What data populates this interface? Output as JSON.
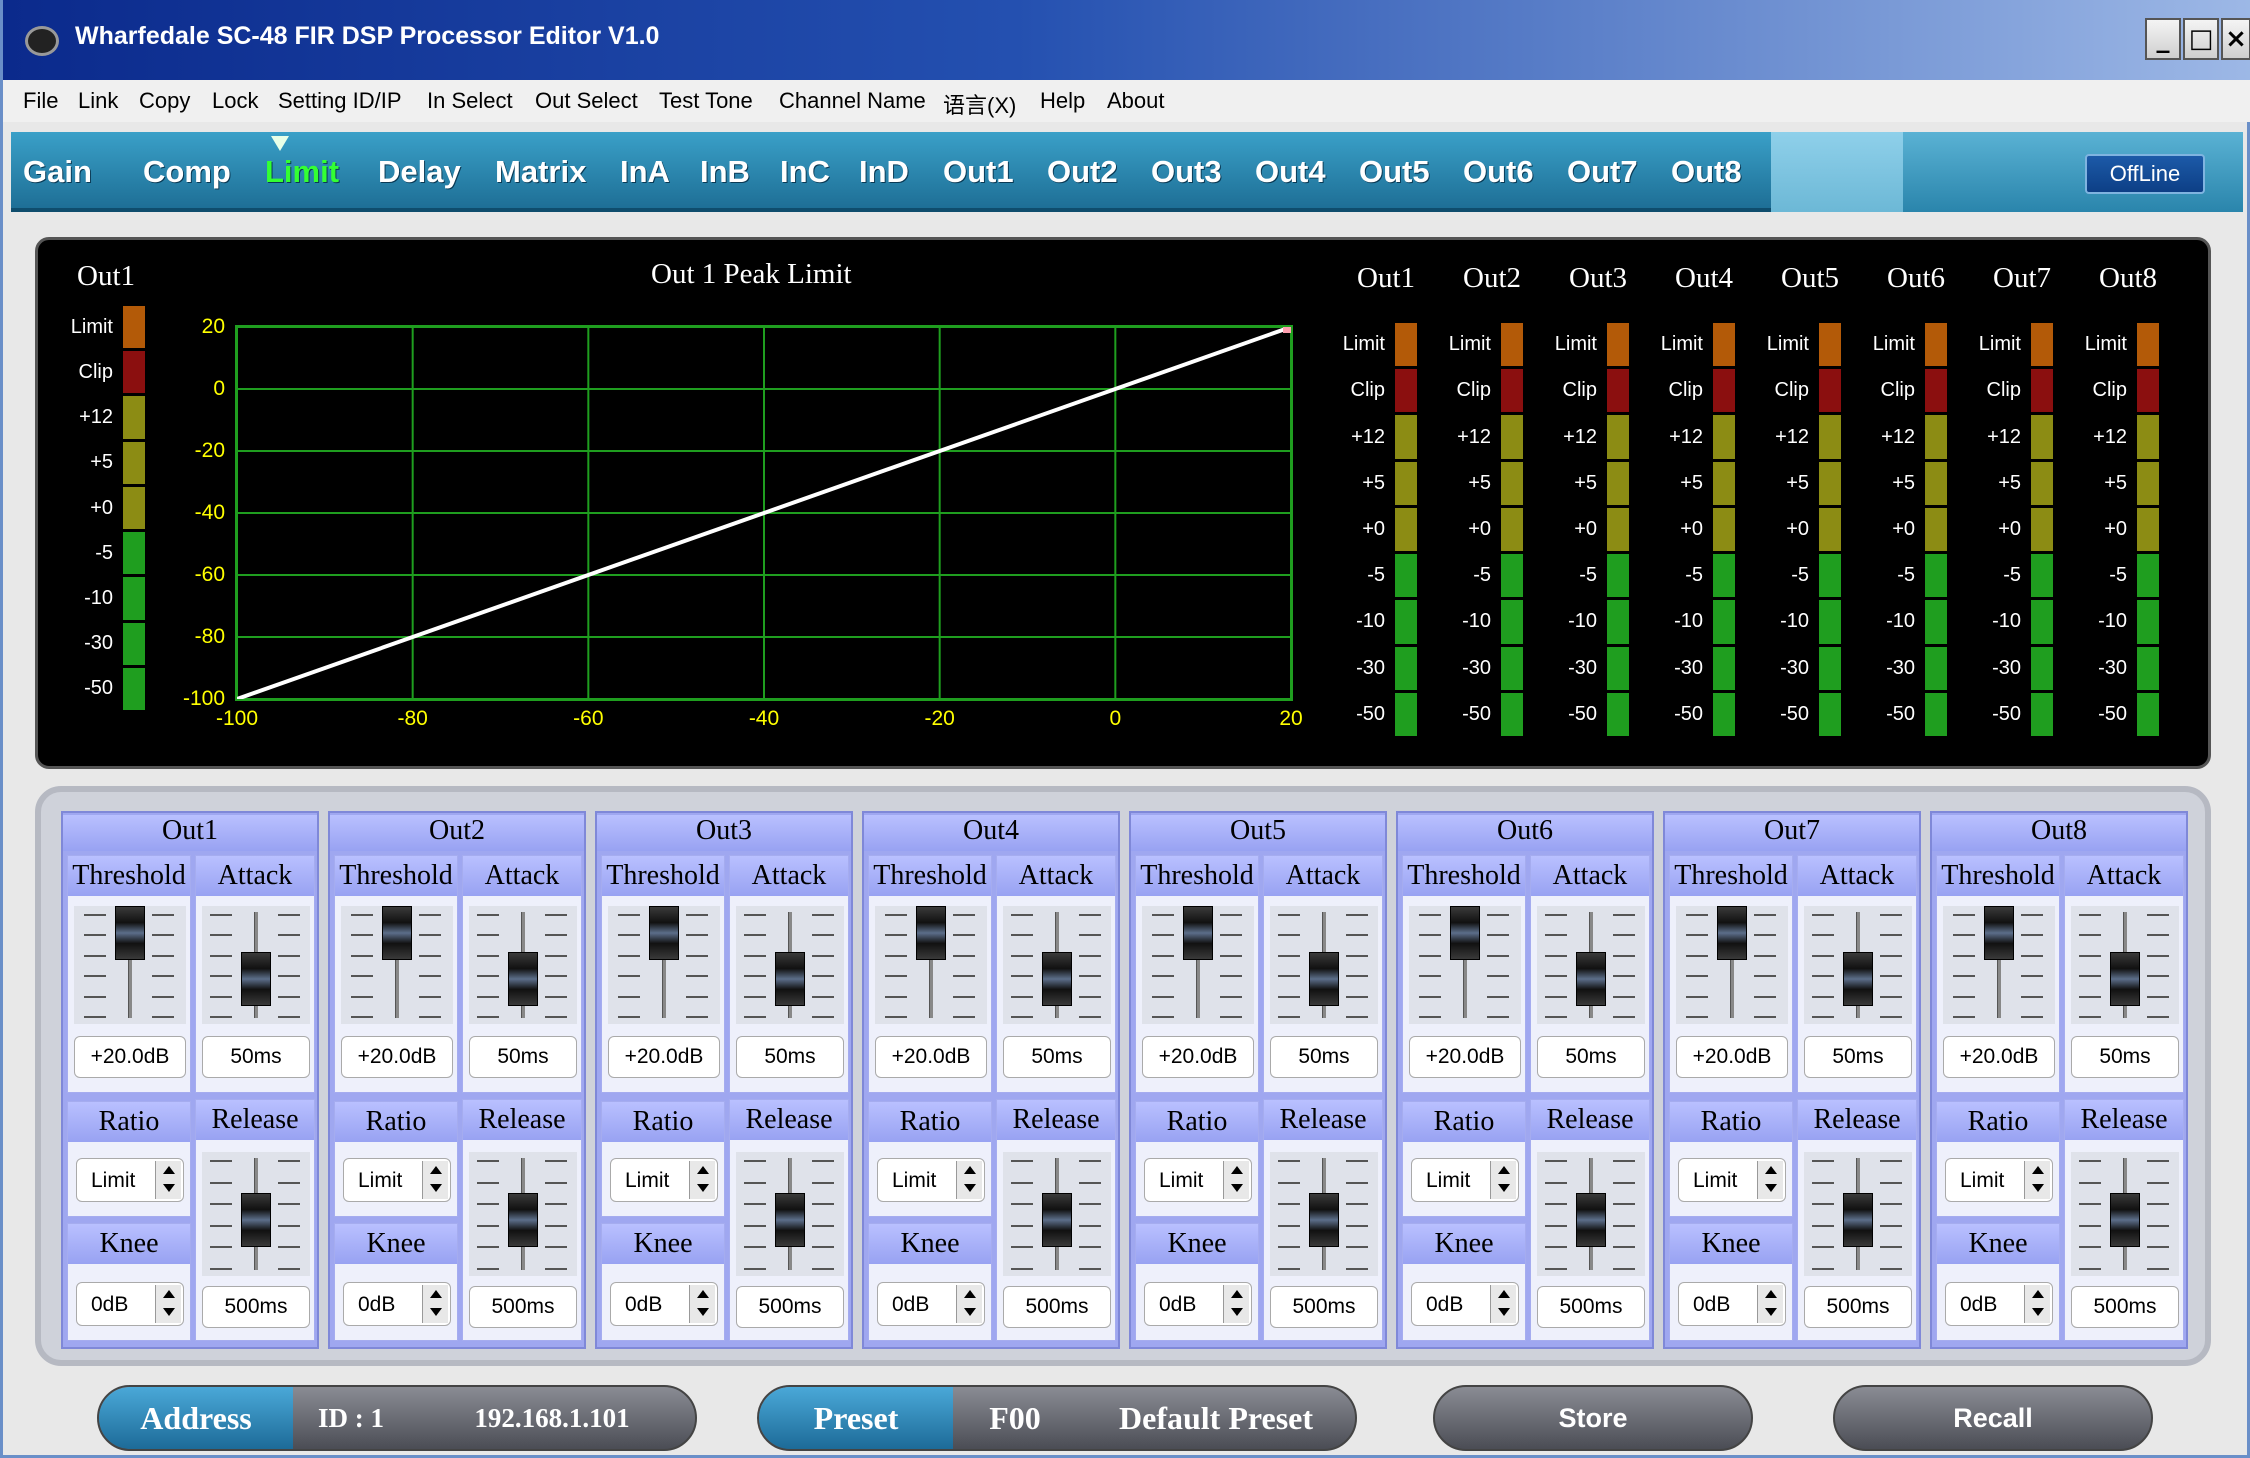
{
  "window": {
    "title": "Wharfedale SC-48 FIR DSP Processor Editor V1.0",
    "controls": [
      "_",
      "□",
      "×"
    ]
  },
  "menu": [
    "File",
    "Link",
    "Copy",
    "Lock",
    "Setting ID/IP",
    "In Select",
    "Out Select",
    "Test Tone",
    "Channel Name",
    "语言(X)",
    "Help",
    "About"
  ],
  "tabs": [
    "Gain",
    "Comp",
    "Limit",
    "Delay",
    "Matrix",
    "InA",
    "InB",
    "InC",
    "InD",
    "Out1",
    "Out2",
    "Out3",
    "Out4",
    "Out5",
    "Out6",
    "Out7",
    "Out8"
  ],
  "active_tab": "Limit",
  "status": "OffLine",
  "display": {
    "left_meter": {
      "channel": "Out1",
      "labels": [
        "Limit",
        "Clip",
        "+12",
        "+5",
        "+0",
        "-5",
        "-10",
        "-30",
        "-50"
      ]
    },
    "graph": {
      "title": "Out 1  Peak Limit",
      "y_ticks": [
        "20",
        "0",
        "-20",
        "-40",
        "-60",
        "-80",
        "-100"
      ],
      "x_ticks": [
        "-100",
        "-80",
        "-60",
        "-40",
        "-20",
        "0",
        "20"
      ],
      "line": {
        "from": [
          -100,
          -100
        ],
        "to": [
          20,
          20
        ]
      }
    },
    "meters": {
      "channels": [
        "Out1",
        "Out2",
        "Out3",
        "Out4",
        "Out5",
        "Out6",
        "Out7",
        "Out8"
      ],
      "labels": [
        "Limit",
        "Clip",
        "+12",
        "+5",
        "+0",
        "-5",
        "-10",
        "-30",
        "-50"
      ]
    },
    "colors": {
      "limit": "#b35a08",
      "clip": "#8b0f0f",
      "yellow": "#8c8c14",
      "green": "#1f9e1f",
      "grid": "#1f9e1f",
      "ticks": "#ffff00"
    }
  },
  "strips": [
    {
      "name": "Out1",
      "threshold": "+20.0dB",
      "attack": "50ms",
      "ratio": "Limit",
      "release": "500ms",
      "knee": "0dB"
    },
    {
      "name": "Out2",
      "threshold": "+20.0dB",
      "attack": "50ms",
      "ratio": "Limit",
      "release": "500ms",
      "knee": "0dB"
    },
    {
      "name": "Out3",
      "threshold": "+20.0dB",
      "attack": "50ms",
      "ratio": "Limit",
      "release": "500ms",
      "knee": "0dB"
    },
    {
      "name": "Out4",
      "threshold": "+20.0dB",
      "attack": "50ms",
      "ratio": "Limit",
      "release": "500ms",
      "knee": "0dB"
    },
    {
      "name": "Out5",
      "threshold": "+20.0dB",
      "attack": "50ms",
      "ratio": "Limit",
      "release": "500ms",
      "knee": "0dB"
    },
    {
      "name": "Out6",
      "threshold": "+20.0dB",
      "attack": "50ms",
      "ratio": "Limit",
      "release": "500ms",
      "knee": "0dB"
    },
    {
      "name": "Out7",
      "threshold": "+20.0dB",
      "attack": "50ms",
      "ratio": "Limit",
      "release": "500ms",
      "knee": "0dB"
    },
    {
      "name": "Out8",
      "threshold": "+20.0dB",
      "attack": "50ms",
      "ratio": "Limit",
      "release": "500ms",
      "knee": "0dB"
    }
  ],
  "strip_labels": {
    "threshold": "Threshold",
    "attack": "Attack",
    "ratio": "Ratio",
    "release": "Release",
    "knee": "Knee"
  },
  "bottom": {
    "address": {
      "label": "Address",
      "id": "ID : 1",
      "ip": "192.168.1.101"
    },
    "preset": {
      "label": "Preset",
      "code": "F00",
      "name": "Default Preset"
    },
    "store": "Store",
    "recall": "Recall"
  }
}
